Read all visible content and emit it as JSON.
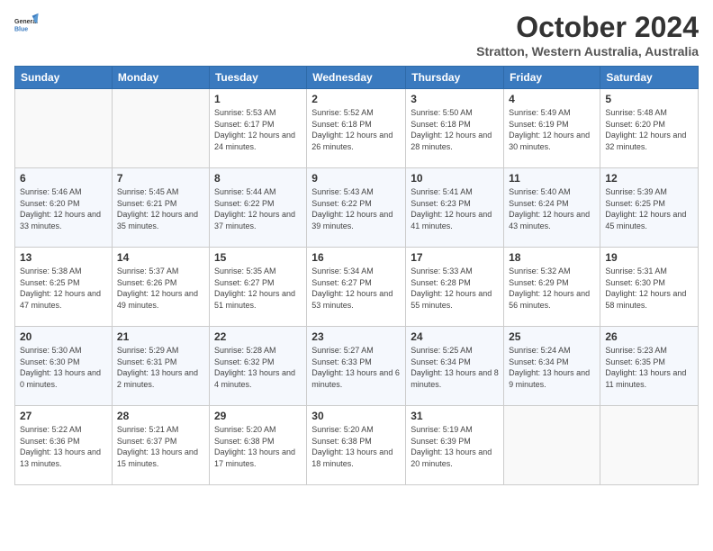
{
  "logo": {
    "line1": "General",
    "line2": "Blue"
  },
  "title": "October 2024",
  "subtitle": "Stratton, Western Australia, Australia",
  "weekdays": [
    "Sunday",
    "Monday",
    "Tuesday",
    "Wednesday",
    "Thursday",
    "Friday",
    "Saturday"
  ],
  "weeks": [
    [
      {
        "day": "",
        "info": ""
      },
      {
        "day": "",
        "info": ""
      },
      {
        "day": "1",
        "info": "Sunrise: 5:53 AM\nSunset: 6:17 PM\nDaylight: 12 hours and 24 minutes."
      },
      {
        "day": "2",
        "info": "Sunrise: 5:52 AM\nSunset: 6:18 PM\nDaylight: 12 hours and 26 minutes."
      },
      {
        "day": "3",
        "info": "Sunrise: 5:50 AM\nSunset: 6:18 PM\nDaylight: 12 hours and 28 minutes."
      },
      {
        "day": "4",
        "info": "Sunrise: 5:49 AM\nSunset: 6:19 PM\nDaylight: 12 hours and 30 minutes."
      },
      {
        "day": "5",
        "info": "Sunrise: 5:48 AM\nSunset: 6:20 PM\nDaylight: 12 hours and 32 minutes."
      }
    ],
    [
      {
        "day": "6",
        "info": "Sunrise: 5:46 AM\nSunset: 6:20 PM\nDaylight: 12 hours and 33 minutes."
      },
      {
        "day": "7",
        "info": "Sunrise: 5:45 AM\nSunset: 6:21 PM\nDaylight: 12 hours and 35 minutes."
      },
      {
        "day": "8",
        "info": "Sunrise: 5:44 AM\nSunset: 6:22 PM\nDaylight: 12 hours and 37 minutes."
      },
      {
        "day": "9",
        "info": "Sunrise: 5:43 AM\nSunset: 6:22 PM\nDaylight: 12 hours and 39 minutes."
      },
      {
        "day": "10",
        "info": "Sunrise: 5:41 AM\nSunset: 6:23 PM\nDaylight: 12 hours and 41 minutes."
      },
      {
        "day": "11",
        "info": "Sunrise: 5:40 AM\nSunset: 6:24 PM\nDaylight: 12 hours and 43 minutes."
      },
      {
        "day": "12",
        "info": "Sunrise: 5:39 AM\nSunset: 6:25 PM\nDaylight: 12 hours and 45 minutes."
      }
    ],
    [
      {
        "day": "13",
        "info": "Sunrise: 5:38 AM\nSunset: 6:25 PM\nDaylight: 12 hours and 47 minutes."
      },
      {
        "day": "14",
        "info": "Sunrise: 5:37 AM\nSunset: 6:26 PM\nDaylight: 12 hours and 49 minutes."
      },
      {
        "day": "15",
        "info": "Sunrise: 5:35 AM\nSunset: 6:27 PM\nDaylight: 12 hours and 51 minutes."
      },
      {
        "day": "16",
        "info": "Sunrise: 5:34 AM\nSunset: 6:27 PM\nDaylight: 12 hours and 53 minutes."
      },
      {
        "day": "17",
        "info": "Sunrise: 5:33 AM\nSunset: 6:28 PM\nDaylight: 12 hours and 55 minutes."
      },
      {
        "day": "18",
        "info": "Sunrise: 5:32 AM\nSunset: 6:29 PM\nDaylight: 12 hours and 56 minutes."
      },
      {
        "day": "19",
        "info": "Sunrise: 5:31 AM\nSunset: 6:30 PM\nDaylight: 12 hours and 58 minutes."
      }
    ],
    [
      {
        "day": "20",
        "info": "Sunrise: 5:30 AM\nSunset: 6:30 PM\nDaylight: 13 hours and 0 minutes."
      },
      {
        "day": "21",
        "info": "Sunrise: 5:29 AM\nSunset: 6:31 PM\nDaylight: 13 hours and 2 minutes."
      },
      {
        "day": "22",
        "info": "Sunrise: 5:28 AM\nSunset: 6:32 PM\nDaylight: 13 hours and 4 minutes."
      },
      {
        "day": "23",
        "info": "Sunrise: 5:27 AM\nSunset: 6:33 PM\nDaylight: 13 hours and 6 minutes."
      },
      {
        "day": "24",
        "info": "Sunrise: 5:25 AM\nSunset: 6:34 PM\nDaylight: 13 hours and 8 minutes."
      },
      {
        "day": "25",
        "info": "Sunrise: 5:24 AM\nSunset: 6:34 PM\nDaylight: 13 hours and 9 minutes."
      },
      {
        "day": "26",
        "info": "Sunrise: 5:23 AM\nSunset: 6:35 PM\nDaylight: 13 hours and 11 minutes."
      }
    ],
    [
      {
        "day": "27",
        "info": "Sunrise: 5:22 AM\nSunset: 6:36 PM\nDaylight: 13 hours and 13 minutes."
      },
      {
        "day": "28",
        "info": "Sunrise: 5:21 AM\nSunset: 6:37 PM\nDaylight: 13 hours and 15 minutes."
      },
      {
        "day": "29",
        "info": "Sunrise: 5:20 AM\nSunset: 6:38 PM\nDaylight: 13 hours and 17 minutes."
      },
      {
        "day": "30",
        "info": "Sunrise: 5:20 AM\nSunset: 6:38 PM\nDaylight: 13 hours and 18 minutes."
      },
      {
        "day": "31",
        "info": "Sunrise: 5:19 AM\nSunset: 6:39 PM\nDaylight: 13 hours and 20 minutes."
      },
      {
        "day": "",
        "info": ""
      },
      {
        "day": "",
        "info": ""
      }
    ]
  ]
}
